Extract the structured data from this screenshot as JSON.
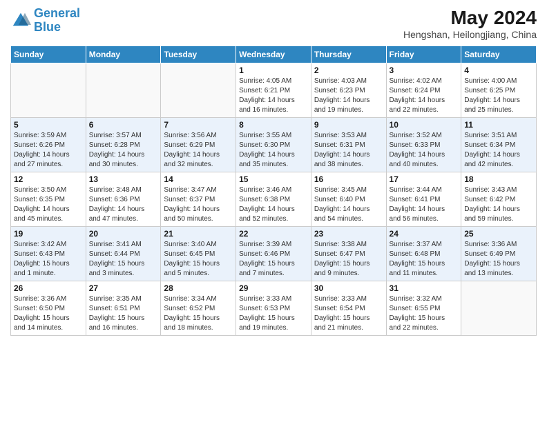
{
  "header": {
    "logo_line1": "General",
    "logo_line2": "Blue",
    "month_year": "May 2024",
    "location": "Hengshan, Heilongjiang, China"
  },
  "days_of_week": [
    "Sunday",
    "Monday",
    "Tuesday",
    "Wednesday",
    "Thursday",
    "Friday",
    "Saturday"
  ],
  "weeks": [
    {
      "row": 1,
      "cells": [
        {
          "day": "",
          "info": ""
        },
        {
          "day": "",
          "info": ""
        },
        {
          "day": "",
          "info": ""
        },
        {
          "day": "1",
          "info": "Sunrise: 4:05 AM\nSunset: 6:21 PM\nDaylight: 14 hours\nand 16 minutes."
        },
        {
          "day": "2",
          "info": "Sunrise: 4:03 AM\nSunset: 6:23 PM\nDaylight: 14 hours\nand 19 minutes."
        },
        {
          "day": "3",
          "info": "Sunrise: 4:02 AM\nSunset: 6:24 PM\nDaylight: 14 hours\nand 22 minutes."
        },
        {
          "day": "4",
          "info": "Sunrise: 4:00 AM\nSunset: 6:25 PM\nDaylight: 14 hours\nand 25 minutes."
        }
      ]
    },
    {
      "row": 2,
      "cells": [
        {
          "day": "5",
          "info": "Sunrise: 3:59 AM\nSunset: 6:26 PM\nDaylight: 14 hours\nand 27 minutes."
        },
        {
          "day": "6",
          "info": "Sunrise: 3:57 AM\nSunset: 6:28 PM\nDaylight: 14 hours\nand 30 minutes."
        },
        {
          "day": "7",
          "info": "Sunrise: 3:56 AM\nSunset: 6:29 PM\nDaylight: 14 hours\nand 32 minutes."
        },
        {
          "day": "8",
          "info": "Sunrise: 3:55 AM\nSunset: 6:30 PM\nDaylight: 14 hours\nand 35 minutes."
        },
        {
          "day": "9",
          "info": "Sunrise: 3:53 AM\nSunset: 6:31 PM\nDaylight: 14 hours\nand 38 minutes."
        },
        {
          "day": "10",
          "info": "Sunrise: 3:52 AM\nSunset: 6:33 PM\nDaylight: 14 hours\nand 40 minutes."
        },
        {
          "day": "11",
          "info": "Sunrise: 3:51 AM\nSunset: 6:34 PM\nDaylight: 14 hours\nand 42 minutes."
        }
      ]
    },
    {
      "row": 3,
      "cells": [
        {
          "day": "12",
          "info": "Sunrise: 3:50 AM\nSunset: 6:35 PM\nDaylight: 14 hours\nand 45 minutes."
        },
        {
          "day": "13",
          "info": "Sunrise: 3:48 AM\nSunset: 6:36 PM\nDaylight: 14 hours\nand 47 minutes."
        },
        {
          "day": "14",
          "info": "Sunrise: 3:47 AM\nSunset: 6:37 PM\nDaylight: 14 hours\nand 50 minutes."
        },
        {
          "day": "15",
          "info": "Sunrise: 3:46 AM\nSunset: 6:38 PM\nDaylight: 14 hours\nand 52 minutes."
        },
        {
          "day": "16",
          "info": "Sunrise: 3:45 AM\nSunset: 6:40 PM\nDaylight: 14 hours\nand 54 minutes."
        },
        {
          "day": "17",
          "info": "Sunrise: 3:44 AM\nSunset: 6:41 PM\nDaylight: 14 hours\nand 56 minutes."
        },
        {
          "day": "18",
          "info": "Sunrise: 3:43 AM\nSunset: 6:42 PM\nDaylight: 14 hours\nand 59 minutes."
        }
      ]
    },
    {
      "row": 4,
      "cells": [
        {
          "day": "19",
          "info": "Sunrise: 3:42 AM\nSunset: 6:43 PM\nDaylight: 15 hours\nand 1 minute."
        },
        {
          "day": "20",
          "info": "Sunrise: 3:41 AM\nSunset: 6:44 PM\nDaylight: 15 hours\nand 3 minutes."
        },
        {
          "day": "21",
          "info": "Sunrise: 3:40 AM\nSunset: 6:45 PM\nDaylight: 15 hours\nand 5 minutes."
        },
        {
          "day": "22",
          "info": "Sunrise: 3:39 AM\nSunset: 6:46 PM\nDaylight: 15 hours\nand 7 minutes."
        },
        {
          "day": "23",
          "info": "Sunrise: 3:38 AM\nSunset: 6:47 PM\nDaylight: 15 hours\nand 9 minutes."
        },
        {
          "day": "24",
          "info": "Sunrise: 3:37 AM\nSunset: 6:48 PM\nDaylight: 15 hours\nand 11 minutes."
        },
        {
          "day": "25",
          "info": "Sunrise: 3:36 AM\nSunset: 6:49 PM\nDaylight: 15 hours\nand 13 minutes."
        }
      ]
    },
    {
      "row": 5,
      "cells": [
        {
          "day": "26",
          "info": "Sunrise: 3:36 AM\nSunset: 6:50 PM\nDaylight: 15 hours\nand 14 minutes."
        },
        {
          "day": "27",
          "info": "Sunrise: 3:35 AM\nSunset: 6:51 PM\nDaylight: 15 hours\nand 16 minutes."
        },
        {
          "day": "28",
          "info": "Sunrise: 3:34 AM\nSunset: 6:52 PM\nDaylight: 15 hours\nand 18 minutes."
        },
        {
          "day": "29",
          "info": "Sunrise: 3:33 AM\nSunset: 6:53 PM\nDaylight: 15 hours\nand 19 minutes."
        },
        {
          "day": "30",
          "info": "Sunrise: 3:33 AM\nSunset: 6:54 PM\nDaylight: 15 hours\nand 21 minutes."
        },
        {
          "day": "31",
          "info": "Sunrise: 3:32 AM\nSunset: 6:55 PM\nDaylight: 15 hours\nand 22 minutes."
        },
        {
          "day": "",
          "info": ""
        }
      ]
    }
  ]
}
